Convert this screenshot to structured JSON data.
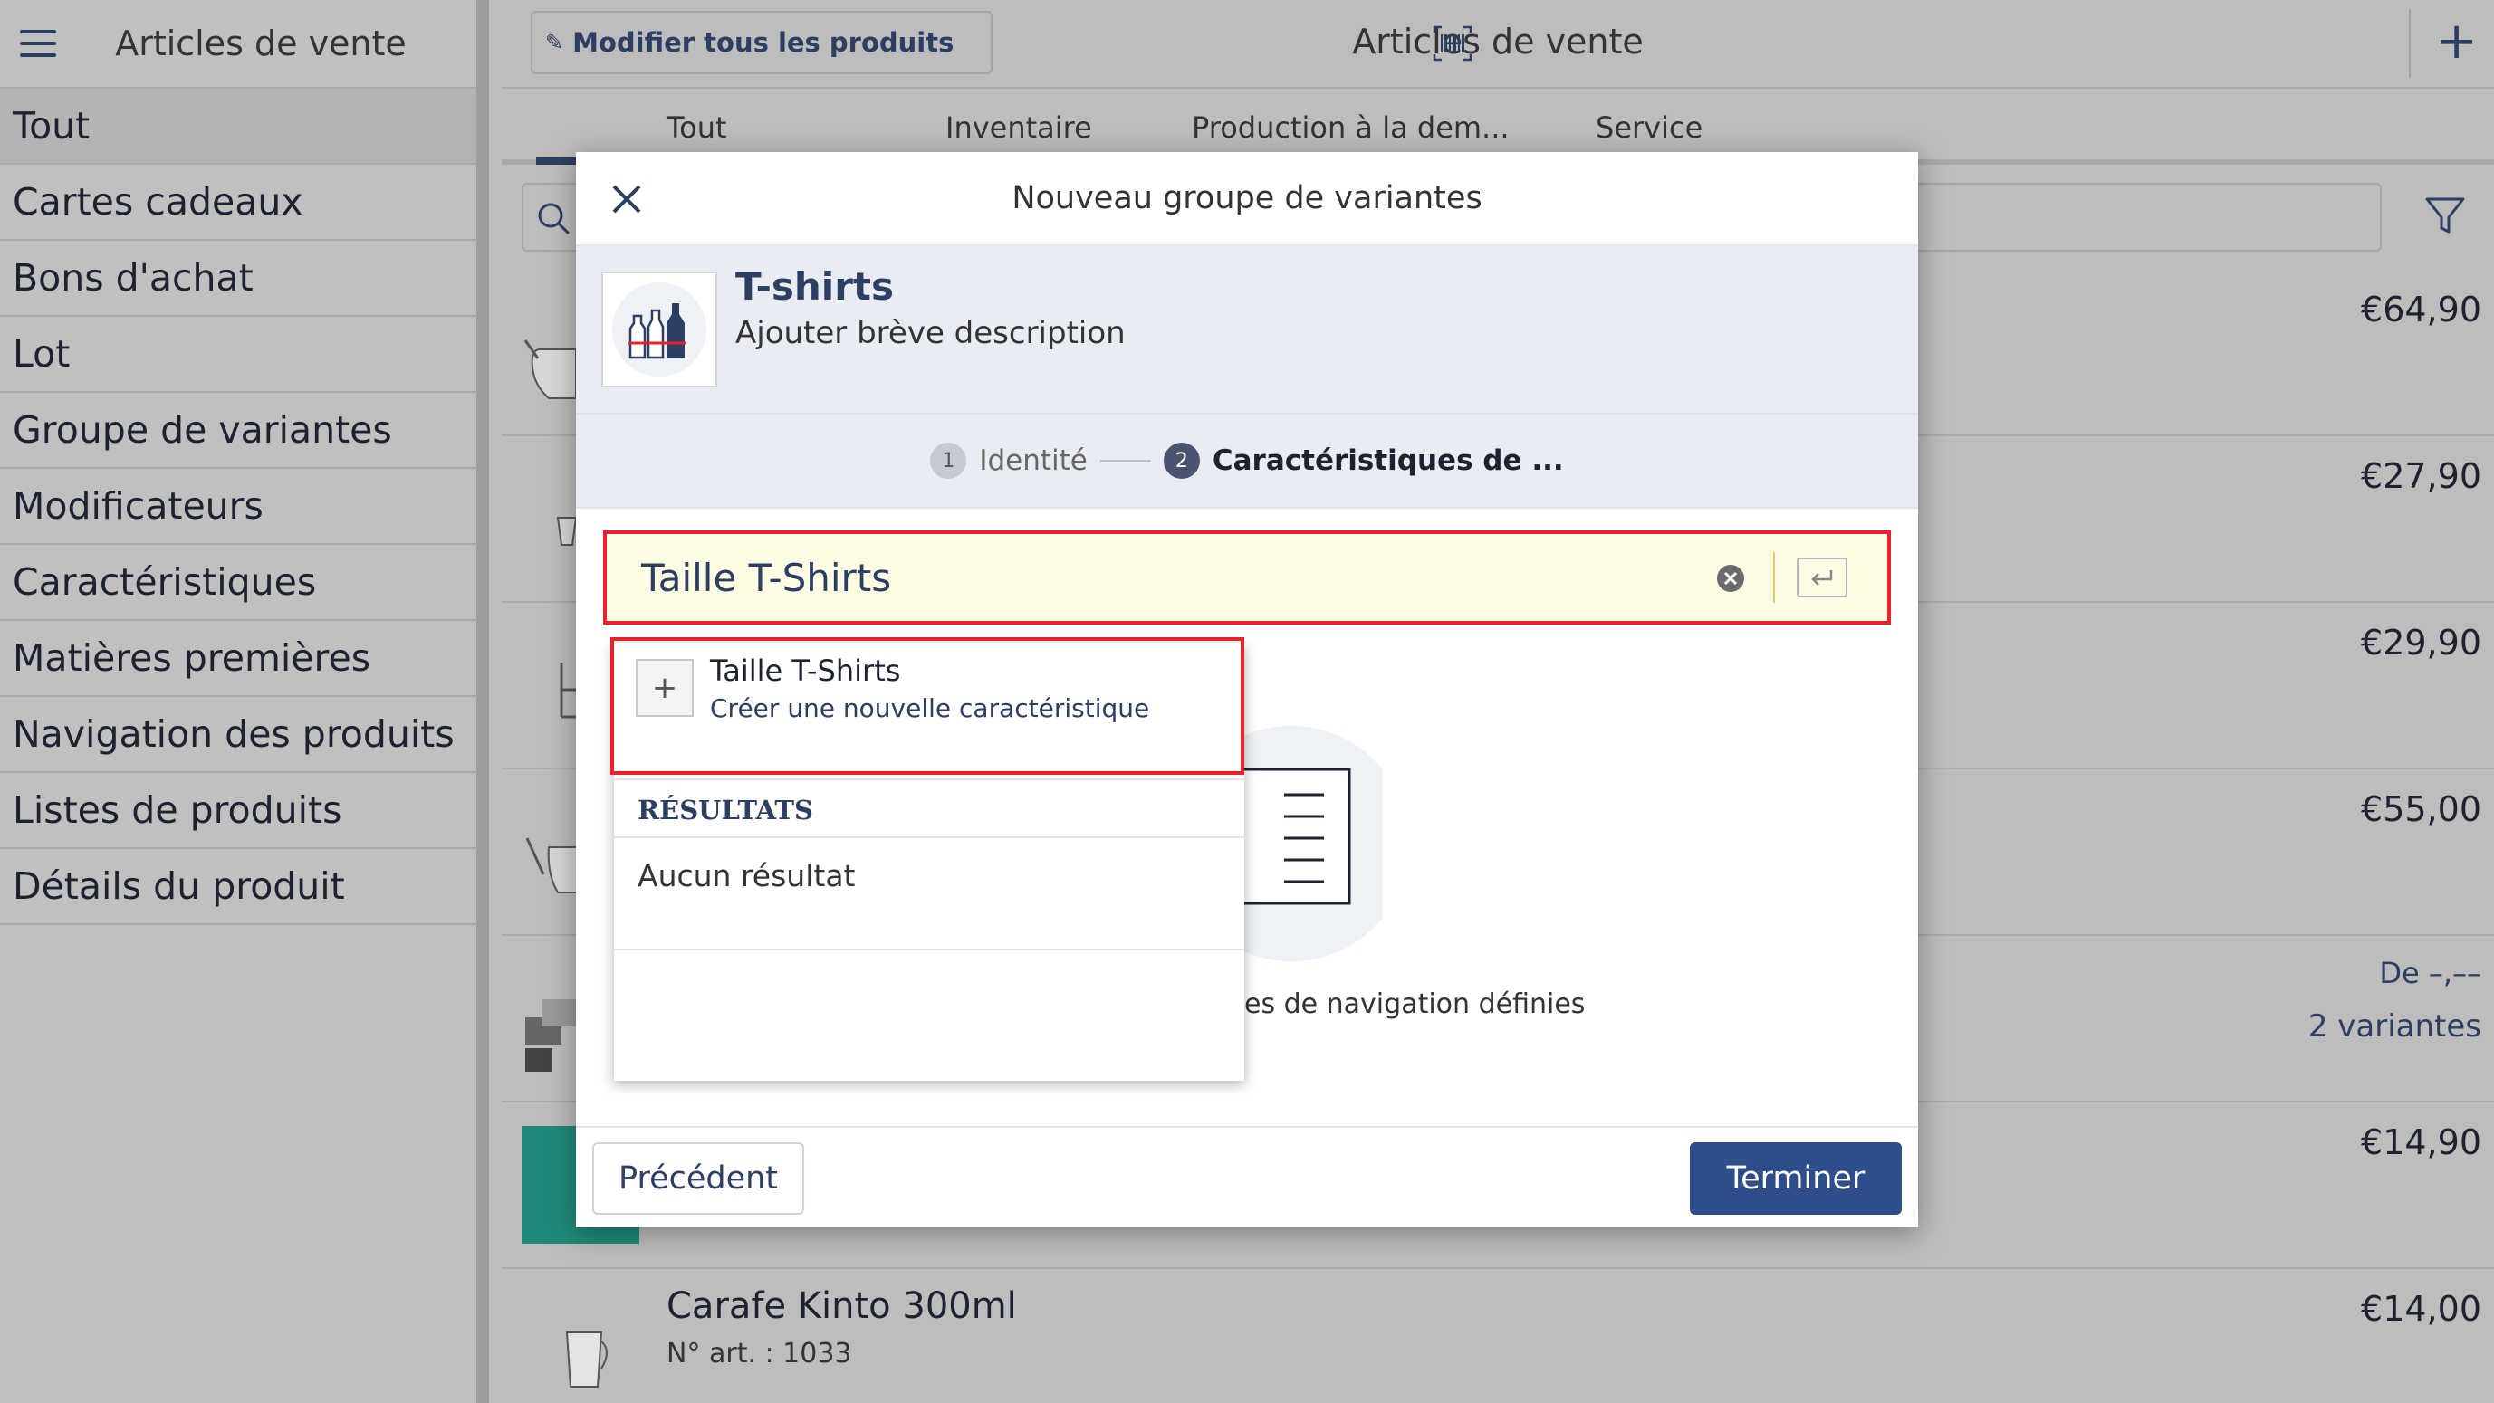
{
  "sidebar": {
    "title": "Articles de vente",
    "menu_icon": "hamburger-icon",
    "items": [
      {
        "label": "Tout"
      },
      {
        "label": "Cartes cadeaux"
      },
      {
        "label": "Bons d'achat"
      },
      {
        "label": "Lot"
      },
      {
        "label": "Groupe de variantes"
      },
      {
        "label": "Modificateurs"
      },
      {
        "label": "Caractéristiques"
      },
      {
        "label": "Matières premières"
      },
      {
        "label": "Navigation des produits"
      },
      {
        "label": "Listes de produits"
      },
      {
        "label": "Détails du produit"
      }
    ]
  },
  "header": {
    "edit_all_label": "Modifier tous les produits",
    "title": "Articles de vente"
  },
  "tabs": [
    {
      "label": "Tout"
    },
    {
      "label": "Inventaire"
    },
    {
      "label": "Production à la dem..."
    },
    {
      "label": "Service"
    }
  ],
  "products": [
    {
      "price": "€64,90"
    },
    {
      "price": "€27,90"
    },
    {
      "price": "€29,90"
    },
    {
      "price": "€55,00"
    },
    {
      "price_from": "De –,––",
      "variants": "2 variantes"
    },
    {
      "price": "€14,90"
    },
    {
      "name": "Carafe Kinto 300ml",
      "sku": "N° art. : 1033",
      "price": "€14,00"
    }
  ],
  "modal": {
    "title": "Nouveau groupe de variantes",
    "product_name": "T-shirts",
    "product_desc": "Ajouter brève description",
    "steps": [
      {
        "num": "1",
        "label": "Identité"
      },
      {
        "num": "2",
        "label": "Caractéristiques de ..."
      }
    ],
    "search_value": "Taille T-Shirts",
    "create_option": {
      "title": "Taille T-Shirts",
      "subtitle": "Créer une nouvelle caractéristique"
    },
    "results_header": "RÉSULTATS",
    "no_results": "Aucun résultat",
    "empty_text": "es de navigation définies",
    "prev_label": "Précédent",
    "finish_label": "Terminer"
  },
  "colors": {
    "accent": "#2d4e8a",
    "highlight_border": "#e8212a",
    "input_bg": "#fdfbe4"
  }
}
